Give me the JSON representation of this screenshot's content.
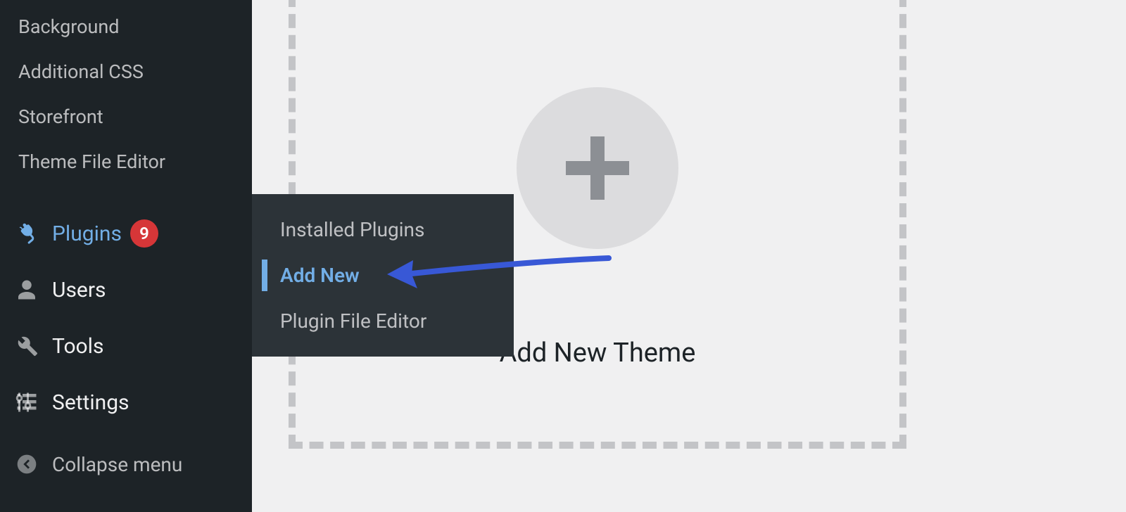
{
  "sidebar": {
    "appearance_submenu": {
      "items": [
        {
          "label": "Background"
        },
        {
          "label": "Additional CSS"
        },
        {
          "label": "Storefront"
        },
        {
          "label": "Theme File Editor"
        }
      ]
    },
    "main_menu": {
      "plugins": {
        "label": "Plugins",
        "badge": "9"
      },
      "users": {
        "label": "Users"
      },
      "tools": {
        "label": "Tools"
      },
      "settings": {
        "label": "Settings"
      }
    },
    "collapse": {
      "label": "Collapse menu"
    }
  },
  "flyout": {
    "items": [
      {
        "label": "Installed Plugins",
        "active": false
      },
      {
        "label": "Add New",
        "active": true
      },
      {
        "label": "Plugin File Editor",
        "active": false
      }
    ]
  },
  "content": {
    "add_theme_label": "Add New Theme"
  },
  "colors": {
    "accent": "#72aee6",
    "badge": "#d63638",
    "annotation_arrow": "#3858d6"
  }
}
